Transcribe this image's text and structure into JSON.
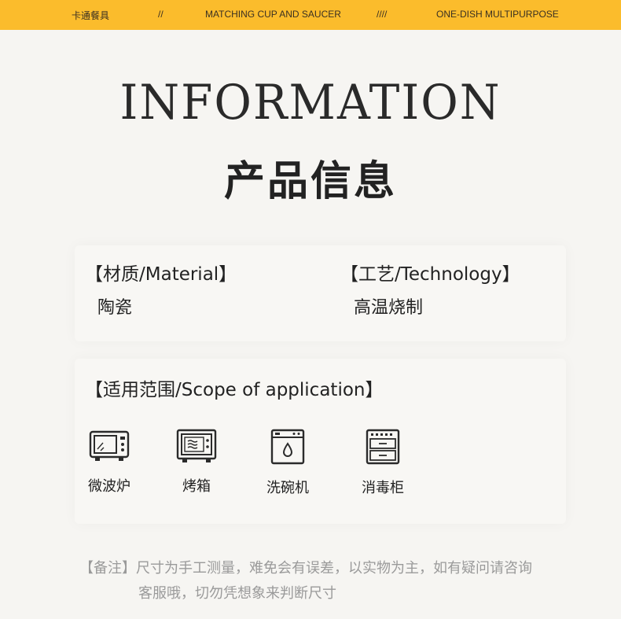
{
  "topbar": {
    "brand": "卡通餐具",
    "sep1": "//",
    "middle": "MATCHING CUP AND SAUCER",
    "sep2": "////",
    "right": "ONE-DISH MULTIPURPOSE"
  },
  "header": {
    "title_en": "INFORMATION",
    "title_cn": "产品信息"
  },
  "material": {
    "label": "【材质/Material】",
    "value": "陶瓷"
  },
  "technology": {
    "label": "【工艺/Technology】",
    "value": "高温烧制"
  },
  "scope": {
    "label": "【适用范围/Scope of application】",
    "items": [
      {
        "label": "微波炉",
        "icon": "microwave-icon"
      },
      {
        "label": "烤箱",
        "icon": "oven-icon"
      },
      {
        "label": "洗碗机",
        "icon": "dishwasher-icon"
      },
      {
        "label": "消毒柜",
        "icon": "sterilizer-cabinet-icon"
      }
    ]
  },
  "note": {
    "line1": "【备注】尺寸为手工测量，难免会有误差，以实物为主，如有疑问请咨询",
    "line2": "客服哦，切勿凭想象来判断尺寸"
  },
  "colors": {
    "topbar": "#fbbc2c",
    "background": "#f6f5f2",
    "text": "#222222",
    "note": "#9a9a9a"
  }
}
